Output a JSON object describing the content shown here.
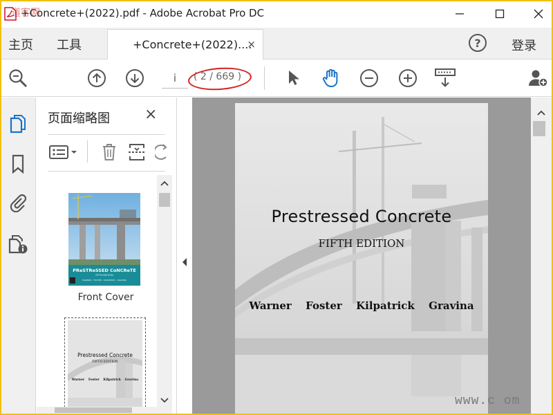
{
  "window": {
    "title": "+Concrete+(2022).pdf - Adobe Acrobat Pro DC",
    "watermark_text": "道客网"
  },
  "menu": {
    "home": "主页",
    "tools": "工具",
    "login": "登录",
    "help_glyph": "?"
  },
  "tab": {
    "label": "+Concrete+(2022)....",
    "close_glyph": "×"
  },
  "toolbar": {
    "page_input_value": "i",
    "page_count": "( 2 / 669 )"
  },
  "panel": {
    "title": "页面缩略图",
    "close_glyph": "×",
    "thumb1_label": "Front Cover",
    "cover_title": "PReSTReSSED CoNCReTE",
    "cover_edition": "FIFTH EDITION",
    "cover_authors": "WARNER · FOSTER · KILPATRICK · GRAVINA",
    "thumb2_title": "Prestressed Concrete",
    "thumb2_edition": "FIFTH EDITION",
    "thumb2_authors": [
      "Warner",
      "Foster",
      "Kilpatrick",
      "Gravina"
    ]
  },
  "document": {
    "title": "Prestressed Concrete",
    "edition": "FIFTH EDITION",
    "authors": [
      "Warner",
      "Foster",
      "Kilpatrick",
      "Gravina"
    ]
  },
  "site_watermark": "www.c      om",
  "colors": {
    "frame_border": "#f2c000",
    "accent_blue": "#1a73c8",
    "oval_red": "#d42020",
    "cover_teal": "#1a8c97"
  }
}
